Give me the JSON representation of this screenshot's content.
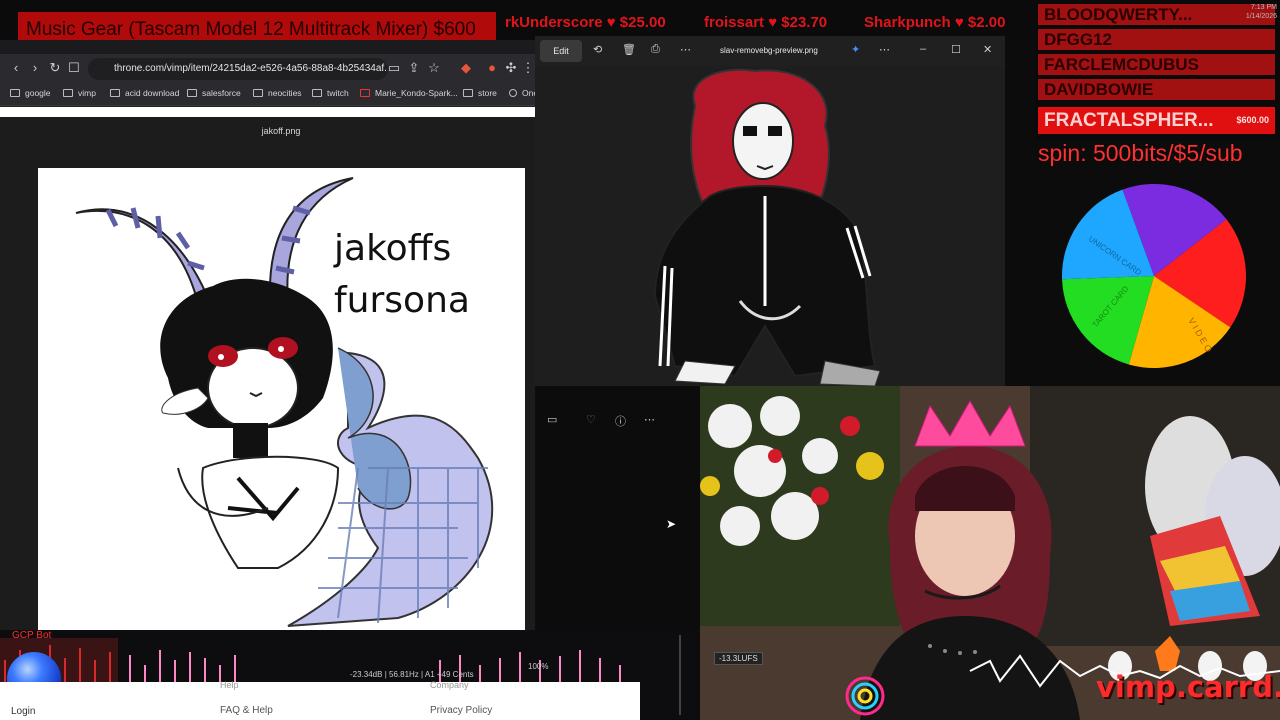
{
  "ticker": {
    "banner": "Music Gear (Tascam Model 12 Multitrack Mixer) $600",
    "items": [
      {
        "text": "rkUnderscore ♥ $25.00"
      },
      {
        "text": "froissart ♥ $23.70"
      },
      {
        "text": "Sharkpunch ♥ $2.00"
      }
    ]
  },
  "browser": {
    "url": "throne.com/vimp/item/24215da2-e526-4a56-88a8-4b25434af...",
    "bookmarks": [
      "google",
      "vimp",
      "acid download",
      "salesforce",
      "neocities",
      "twitch",
      "Marie_Kondo-Spark...",
      "store",
      "One"
    ],
    "image_title": "jakoff.png",
    "drawing_text_line1": "jakoffs",
    "drawing_text_line2": "fursona"
  },
  "photos": {
    "edit_label": "Edit",
    "title": "slav-removebg-preview.png"
  },
  "donors": [
    {
      "name": "BLOODQWERTY...",
      "amount": ""
    },
    {
      "name": "DFGG12",
      "amount": ""
    },
    {
      "name": "FARCLEMCDUBUS",
      "amount": ""
    },
    {
      "name": "DAVIDBOWIE",
      "amount": ""
    },
    {
      "name": "FRACTALSPHER...",
      "amount": "$600.00"
    }
  ],
  "clock": {
    "time": "7:13 PM",
    "date": "1/14/2026"
  },
  "spin_text": "spin: 500bits/$5/sub",
  "wheel": {
    "segments": [
      {
        "label": "",
        "color": "#7b2be0"
      },
      {
        "label": "",
        "color": "#ff1e1e"
      },
      {
        "label": "V I D E O",
        "color": "#ffb400"
      },
      {
        "label": "TAROT CARD",
        "color": "#22dd22"
      },
      {
        "label": "UNICORN CARD",
        "color": "#1fa6ff"
      }
    ]
  },
  "cam": {
    "lufs": "-13.3LUFS",
    "carrd": "vimp.carrd.co"
  },
  "bottom": {
    "bot_label": "GCP Bot",
    "meter_text": "-23.34dB | 56.81Hz | A1 +49 Cents",
    "zoom": "100%",
    "login": "Login",
    "help": "Help",
    "company": "Company",
    "faq": "FAQ & Help",
    "privacy": "Privacy Policy"
  },
  "colors": {
    "accent_red": "#e0151b",
    "banner_red": "#b10a0a"
  }
}
